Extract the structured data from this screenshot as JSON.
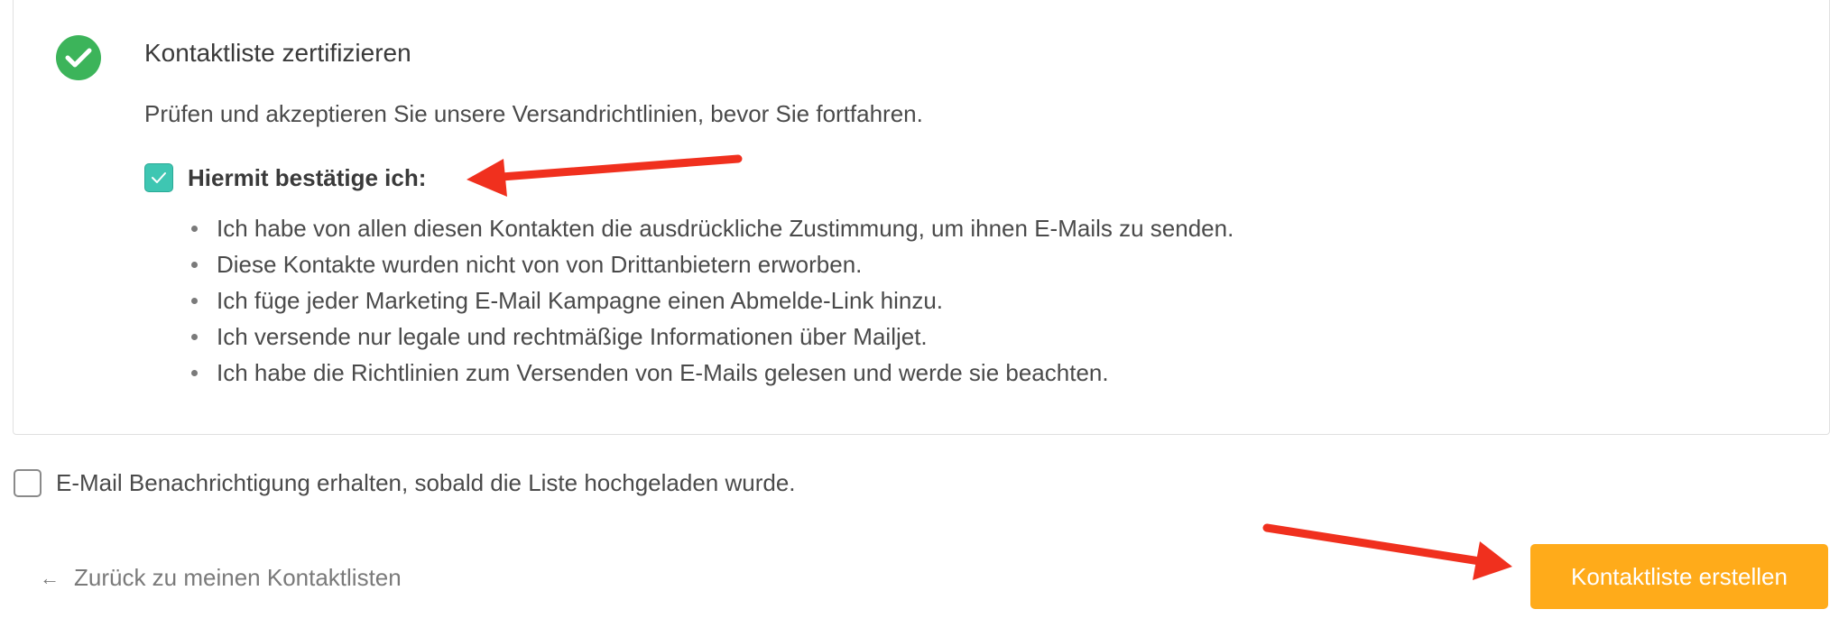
{
  "certify": {
    "title": "Kontaktliste zertifizieren",
    "subtitle": "Prüfen und akzeptieren Sie unsere Versandrichtlinien, bevor Sie fortfahren.",
    "confirm_label": "Hiermit bestätige ich:",
    "confirm_checked": true,
    "rules": [
      "Ich habe von allen diesen Kontakten die ausdrückliche Zustimmung, um ihnen E-Mails zu senden.",
      "Diese Kontakte wurden nicht von von Drittanbietern erworben.",
      "Ich füge jeder Marketing E-Mail Kampagne einen Abmelde-Link hinzu.",
      "Ich versende nur legale und rechtmäßige Informationen über Mailjet.",
      "Ich habe die Richtlinien zum Versenden von E-Mails gelesen und werde sie beachten."
    ]
  },
  "notify": {
    "label": "E-Mail Benachrichtigung erhalten, sobald die Liste hochgeladen wurde.",
    "checked": false
  },
  "footer": {
    "back_arrow": "←",
    "back_label": "Zurück zu meinen Kontaktlisten",
    "create_label": "Kontaktliste erstellen"
  },
  "colors": {
    "success_green": "#3cb45a",
    "checkbox_teal": "#3ec6b2",
    "button_orange": "#ffab1a",
    "annotation_red": "#f0301e"
  },
  "icons": {
    "status": "check-circle-icon",
    "back": "arrow-left-icon",
    "annotations": "red-arrow-icon"
  }
}
